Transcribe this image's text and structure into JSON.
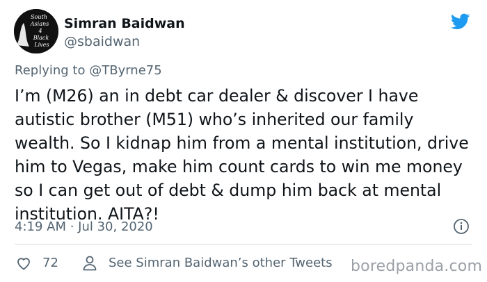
{
  "author": {
    "name": "Simran Baidwan",
    "handle": "@sbaidwan",
    "avatar_text": [
      "South",
      "Asians",
      "4",
      "Black",
      "Lives"
    ]
  },
  "reply": {
    "prefix": "Replying to",
    "mention": "@TByrne75"
  },
  "tweet": {
    "text": "I’m (M26) an in debt car dealer & discover I have autistic brother (M51) who’s inherited our family wealth. So I kidnap him from a mental institution, drive him to Vegas, make him count cards to win me money so I can get out of debt & dump him back at mental institution. AITA?!",
    "timestamp": "4:19 AM · Jul 30, 2020"
  },
  "actions": {
    "like_count": "72",
    "see_more_label": "See Simran Baidwan’s other Tweets"
  },
  "watermark": "boredpanda.com",
  "colors": {
    "twitter_blue": "#1d9bf0",
    "secondary_text": "#536471",
    "divider": "#cfd9de"
  },
  "icons": [
    "twitter-bird-icon",
    "info-icon",
    "heart-icon",
    "person-icon"
  ]
}
